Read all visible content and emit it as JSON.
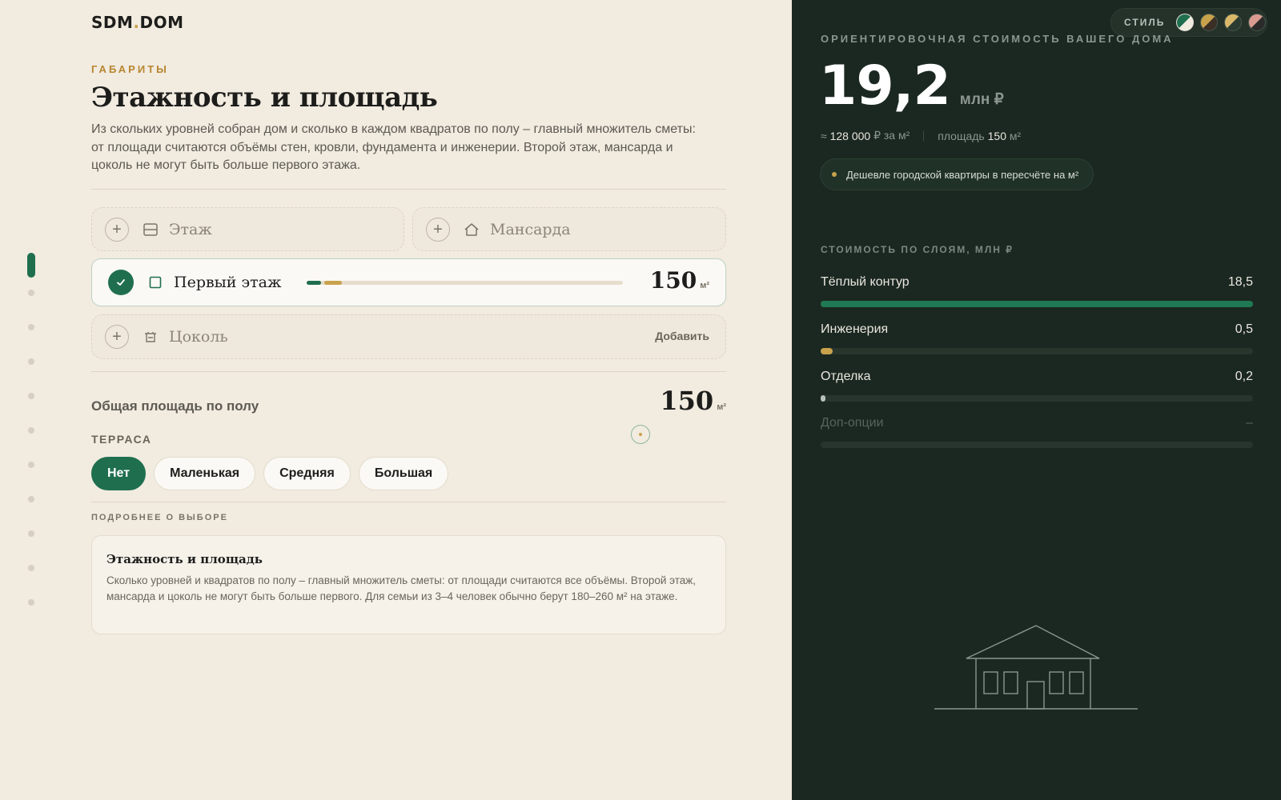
{
  "app": {
    "logo_left": "SDM",
    "logo_dot": ".",
    "logo_right": "DOM"
  },
  "colors": {
    "accent": "#1f6f4f",
    "gold": "#c9a24c",
    "panel_dark": "#1b2821",
    "bg": "#f1ebe0"
  },
  "nav": {
    "steps": 11,
    "active_step": 1
  },
  "section": {
    "eyebrow": "ГАБАРИТЫ",
    "title": "Этажность и площадь",
    "lead": "Из скольких уровней собран дом и сколько в каждом квадратов по полу – главный множитель сметы: от площади считаются объёмы стен, кровли, фундамента и инженерии. Второй этаж, мансарда и цоколь не могут быть больше первого этажа."
  },
  "options": {
    "floor": {
      "label": "Этаж",
      "icon": "floor-plan-icon"
    },
    "attic": {
      "label": "Мансарда",
      "icon": "house-icon"
    },
    "first_floor": {
      "label": "Первый этаж",
      "value": "150",
      "unit": "м²",
      "icon": "square-icon",
      "fill_fraction": 0.11
    },
    "basement": {
      "label": "Цоколь",
      "action": "Добавить",
      "icon": "basement-icon"
    }
  },
  "total": {
    "label": "Общая площадь по полу",
    "value": "150",
    "unit": "м²"
  },
  "terrace": {
    "label": "ТЕРРАСА",
    "choices": [
      "Нет",
      "Маленькая",
      "Средняя",
      "Большая"
    ],
    "selected": "Нет"
  },
  "details": {
    "label": "ПОДРОБНЕЕ О ВЫБОРЕ",
    "title": "Этажность и площадь",
    "body": "Сколько уровней и квадратов по полу – главный множитель сметы: от площади считаются все объёмы. Второй этаж, мансарда и цоколь не могут быть больше первого. Для семьи из 3–4 человек обычно берут 180–260 м² на этаже."
  },
  "style_switcher": {
    "label": "СТИЛЬ",
    "active_index": 0
  },
  "estimate": {
    "eyebrow": "ОРИЕНТИРОВОЧНАЯ СТОИМОСТЬ ВАШЕГО ДОМА",
    "price": "19,2",
    "price_unit": "млн ₽",
    "per_m2_prefix": "≈",
    "per_m2_value": "128 000",
    "per_m2_suffix": "₽ за м²",
    "area_prefix": "площадь",
    "area_value": "150",
    "area_unit": "м²",
    "badge": "Дешевле городской квартиры в пересчёте на м²"
  },
  "layers": {
    "label": "СТОИМОСТЬ ПО СЛОЯМ, МЛН ₽",
    "items": [
      {
        "name": "Тёплый контур",
        "value": "18,5",
        "fraction": 1.0,
        "color": "#1f7a53"
      },
      {
        "name": "Инженерия",
        "value": "0,5",
        "fraction": 0.027,
        "color": "#c9a24c"
      },
      {
        "name": "Отделка",
        "value": "0,2",
        "fraction": 0.011,
        "color": "#b8c2bb"
      },
      {
        "name": "Доп-опции",
        "value": "–",
        "fraction": 0,
        "color": "#56645b"
      }
    ]
  }
}
